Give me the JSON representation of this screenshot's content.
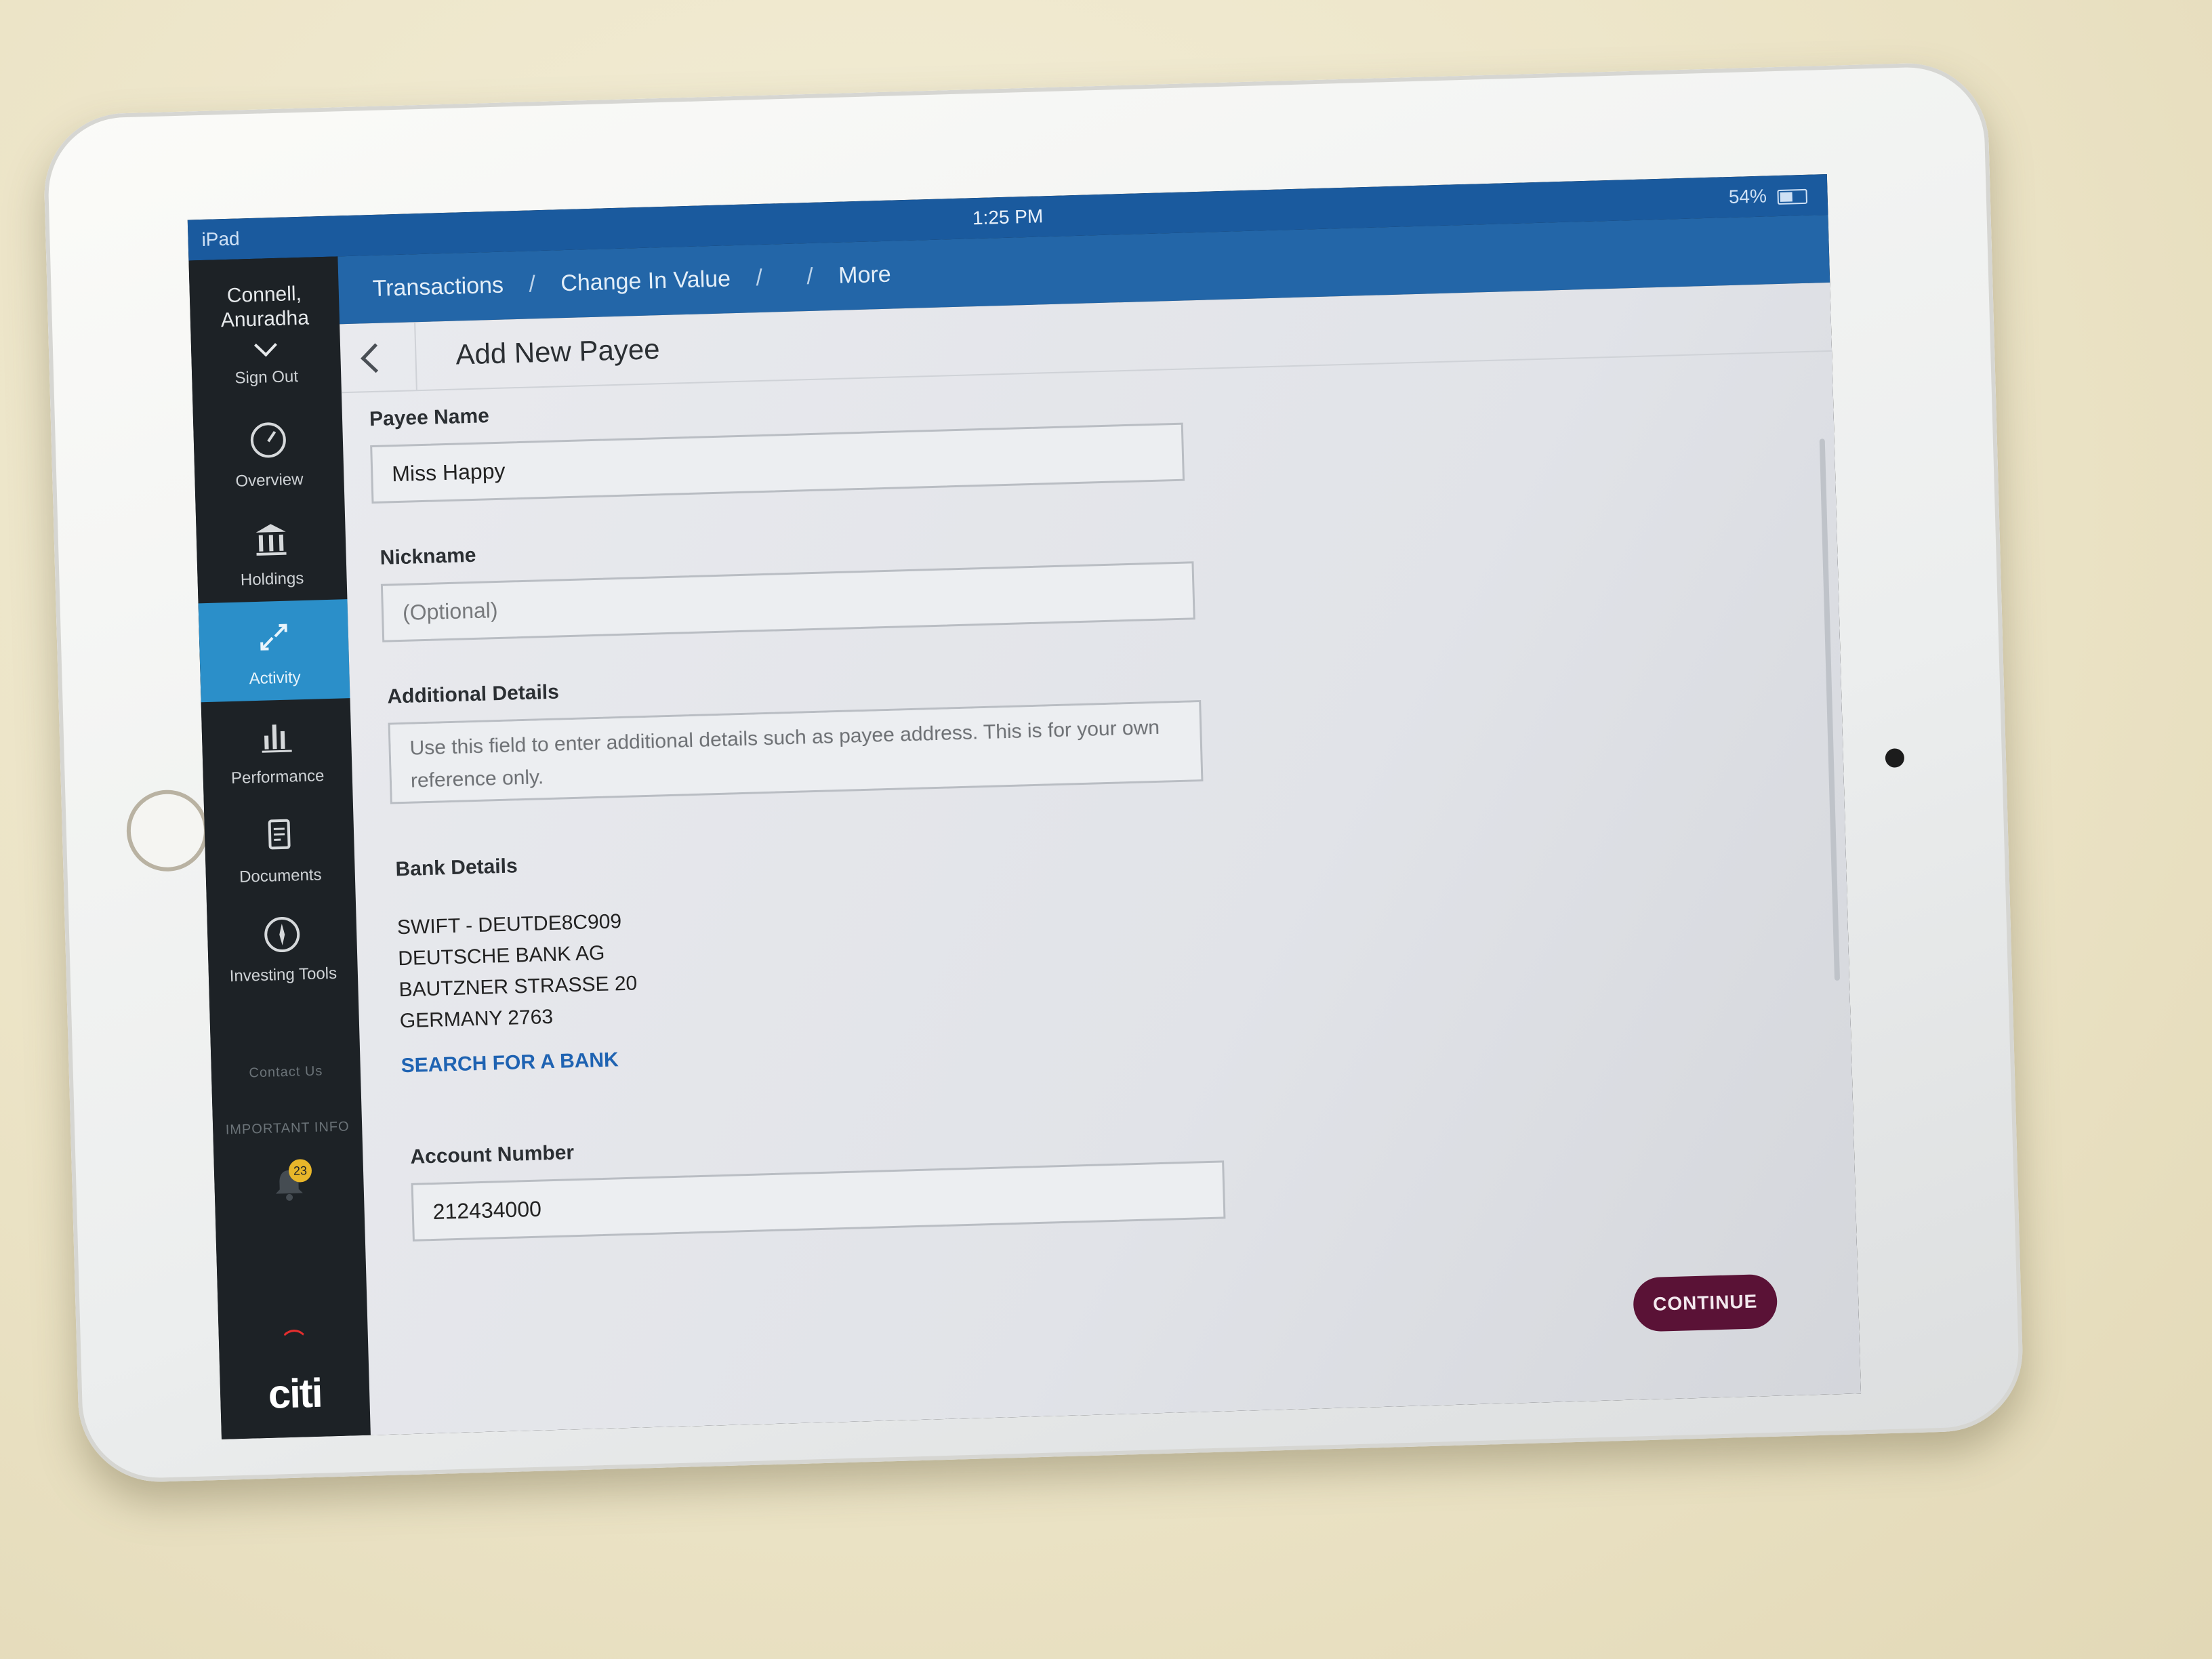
{
  "status_bar": {
    "device": "iPad",
    "time": "1:25 PM",
    "battery": "54%"
  },
  "sidebar": {
    "user_name_line1": "Connell,",
    "user_name_line2": "Anuradha",
    "sign_out": "Sign Out",
    "items": [
      {
        "label": "Overview",
        "icon": "gauge-icon"
      },
      {
        "label": "Holdings",
        "icon": "bank-icon"
      },
      {
        "label": "Activity",
        "icon": "arrows-icon",
        "active": true
      },
      {
        "label": "Performance",
        "icon": "bar-chart-icon"
      },
      {
        "label": "Documents",
        "icon": "document-icon"
      },
      {
        "label": "Investing Tools",
        "icon": "compass-icon"
      }
    ],
    "contact_us": "Contact Us",
    "important_info": "IMPORTANT INFO",
    "notification_count": "23",
    "logo": "citi"
  },
  "breadcrumb": [
    "Transactions",
    "Change In Value",
    "",
    "More"
  ],
  "page": {
    "title": "Add New Payee",
    "payee_name_label": "Payee Name",
    "payee_name_value": "Miss Happy",
    "nickname_label": "Nickname",
    "nickname_placeholder": "(Optional)",
    "additional_details_label": "Additional Details",
    "additional_details_placeholder": "Use this field to enter additional details such as payee address. This is for your own reference only.",
    "bank_details_label": "Bank Details",
    "bank_lines": [
      "SWIFT - DEUTDE8C909",
      "DEUTSCHE BANK AG",
      "BAUTZNER STRASSE 20",
      "GERMANY 2763"
    ],
    "search_bank_link": "SEARCH FOR A BANK",
    "account_number_label": "Account Number",
    "account_number_value": "212434000",
    "continue_button": "CONTINUE"
  },
  "colors": {
    "topbar": "#2366a8",
    "sidebar": "#1d2226",
    "active_nav": "#2b8fc9",
    "continue_button": "#5a1236",
    "link": "#1f63b2"
  }
}
